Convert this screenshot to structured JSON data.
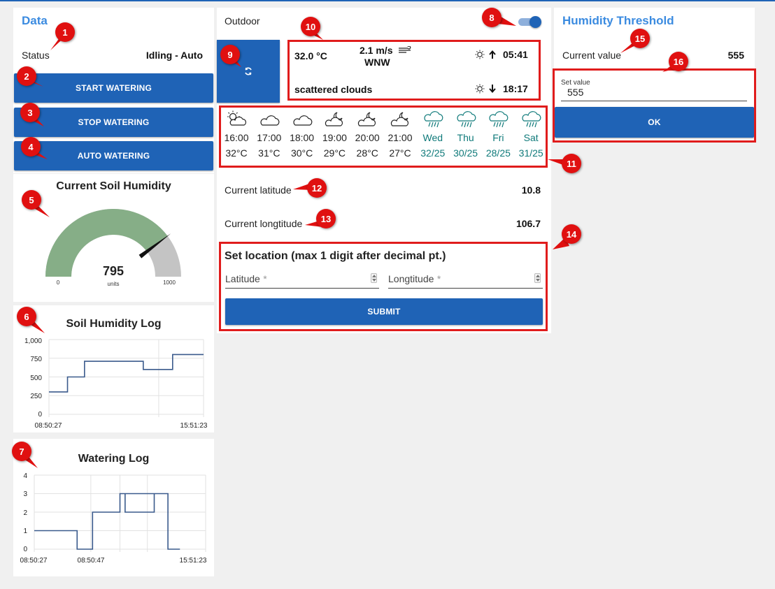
{
  "data_panel": {
    "title": "Data",
    "status_label": "Status",
    "status_value": "Idling - Auto",
    "start_watering": "START WATERING",
    "stop_watering": "STOP WATERING",
    "auto_watering": "AUTO WATERING"
  },
  "gauge": {
    "title": "Current Soil Humidity",
    "value": 795,
    "value_text": "795",
    "units": "units",
    "min": 0,
    "min_text": "0",
    "max": 1000,
    "max_text": "1000",
    "color_fill": "#86ae87",
    "color_track": "#c4c4c4"
  },
  "soil_log": {
    "title": "Soil Humidity Log",
    "x_labels": [
      "08:50:27",
      "15:51:23"
    ],
    "y_ticks": [
      "1,000",
      "750",
      "500",
      "250",
      "0"
    ]
  },
  "watering_log": {
    "title": "Watering Log",
    "x_labels": [
      "08:50:27",
      "08:50:47",
      "15:51:23"
    ],
    "y_ticks": [
      "4",
      "3",
      "2",
      "1",
      "0"
    ]
  },
  "chart_data": [
    {
      "type": "line",
      "title": "Soil Humidity Log",
      "step": true,
      "ylim": [
        0,
        1000
      ],
      "series": [
        {
          "values": [
            [
              0,
              300
            ],
            [
              0.12,
              300
            ],
            [
              0.12,
              500
            ],
            [
              0.23,
              500
            ],
            [
              0.23,
              710
            ],
            [
              0.61,
              710
            ],
            [
              0.61,
              600
            ],
            [
              0.8,
              600
            ],
            [
              0.8,
              800
            ],
            [
              1,
              800
            ]
          ]
        }
      ],
      "x_tick_labels": [
        "08:50:27",
        "15:51:23"
      ],
      "grid": true
    },
    {
      "type": "line",
      "title": "Watering Log",
      "step": true,
      "ylim": [
        0,
        4
      ],
      "series": [
        {
          "values": [
            [
              0,
              1
            ],
            [
              0.25,
              1
            ],
            [
              0.25,
              0
            ],
            [
              0.34,
              0
            ],
            [
              0.34,
              2
            ],
            [
              0.5,
              2
            ],
            [
              0.5,
              3
            ],
            [
              0.7,
              3
            ],
            [
              0.7,
              2
            ],
            [
              0.53,
              2
            ],
            [
              0.53,
              3
            ],
            [
              0.78,
              3
            ],
            [
              0.78,
              0
            ],
            [
              0.85,
              0
            ]
          ]
        }
      ],
      "x_tick_labels": [
        "08:50:27",
        "08:50:47",
        "15:51:23"
      ],
      "grid": true
    }
  ],
  "outdoor": {
    "label": "Outdoor",
    "toggle_on": true,
    "accent": "#1f63b6"
  },
  "weather": {
    "temperature": "32.0 °C",
    "wind_speed": "2.1 m/s",
    "wind_dir": "WNW",
    "description": "scattered clouds",
    "sunrise": "05:41",
    "sunset": "18:17"
  },
  "forecast": [
    {
      "time": "16:00",
      "temp": "32°C",
      "icon": "sun-cloud-icon",
      "day": false
    },
    {
      "time": "17:00",
      "temp": "31°C",
      "icon": "cloud-icon",
      "day": false
    },
    {
      "time": "18:00",
      "temp": "30°C",
      "icon": "cloud-icon",
      "day": false
    },
    {
      "time": "19:00",
      "temp": "29°C",
      "icon": "night-cloud-icon",
      "day": false
    },
    {
      "time": "20:00",
      "temp": "28°C",
      "icon": "night-cloud-icon",
      "day": false
    },
    {
      "time": "21:00",
      "temp": "27°C",
      "icon": "night-cloud-icon",
      "day": false
    },
    {
      "time": "Wed",
      "temp": "32/25",
      "icon": "rain-icon",
      "day": true
    },
    {
      "time": "Thu",
      "temp": "30/25",
      "icon": "rain-icon",
      "day": true
    },
    {
      "time": "Fri",
      "temp": "28/25",
      "icon": "rain-icon",
      "day": true
    },
    {
      "time": "Sat",
      "temp": "31/25",
      "icon": "rain-icon",
      "day": true
    }
  ],
  "location": {
    "lat_label": "Current latitude",
    "lat_value": "10.8",
    "lon_label": "Current longtitude",
    "lon_value": "106.7",
    "set_title": "Set location (max 1 digit after decimal pt.)",
    "lat_field": "Latitude",
    "lon_field": "Longtitude",
    "required_mark": "*",
    "submit": "SUBMIT"
  },
  "threshold": {
    "title": "Humidity Threshold",
    "current_label": "Current value",
    "current_value": "555",
    "set_label": "Set value",
    "set_value": "555",
    "ok": "OK"
  },
  "annotations": [
    "1",
    "2",
    "3",
    "4",
    "5",
    "6",
    "7",
    "8",
    "9",
    "10",
    "11",
    "12",
    "13",
    "14",
    "15",
    "16"
  ]
}
